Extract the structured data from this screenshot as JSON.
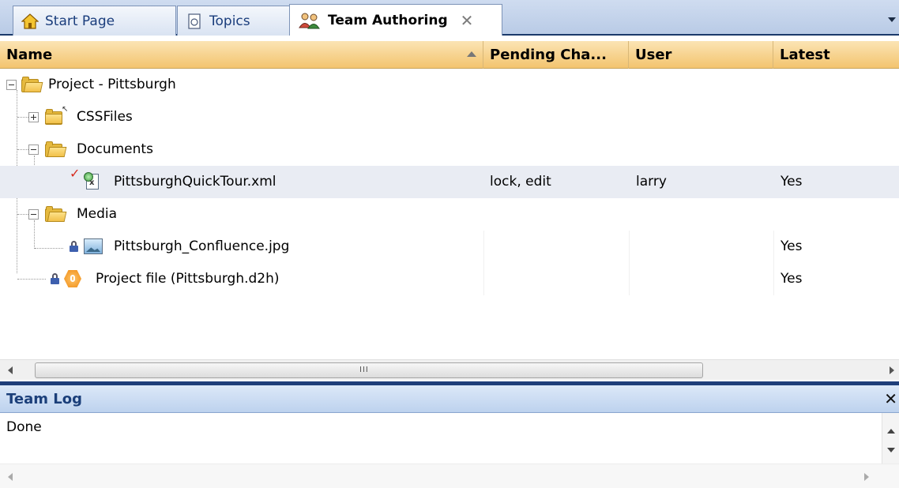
{
  "tabs": [
    {
      "label": "Start Page",
      "icon": "home-icon",
      "active": false
    },
    {
      "label": "Topics",
      "icon": "topic-document-icon",
      "active": false
    },
    {
      "label": "Team Authoring",
      "icon": "team-users-icon",
      "active": true
    }
  ],
  "tab_close_glyph": "✕",
  "columns": {
    "name": "Name",
    "pending": "Pending Cha...",
    "user": "User",
    "latest": "Latest"
  },
  "tree": {
    "root": {
      "label": "Project - Pittsburgh",
      "expanded": true
    },
    "cssfiles": {
      "label": "CSSFiles",
      "expanded": false
    },
    "documents": {
      "label": "Documents",
      "expanded": true
    },
    "quicktour": {
      "label": "PittsburghQuickTour.xml",
      "pending": "lock, edit",
      "user": "larry",
      "latest": "Yes",
      "status": "checked-out",
      "selected": true
    },
    "media": {
      "label": "Media",
      "expanded": true
    },
    "confluence": {
      "label": "Pittsburgh_Confluence.jpg",
      "pending": "",
      "user": "",
      "latest": "Yes",
      "status": "locked"
    },
    "projectfile": {
      "label": "Project file (Pittsburgh.d2h)",
      "pending": "",
      "user": "",
      "latest": "Yes",
      "status": "locked"
    }
  },
  "grid_scroll_grip": "III",
  "team_log": {
    "title": "Team Log",
    "close_glyph": "✕",
    "text": "Done"
  },
  "colors": {
    "accent_dark_blue": "#1e3e7a",
    "header_orange": "#f3c46f",
    "selected_row": "#e9ecf3",
    "check_red": "#d62b1e"
  }
}
